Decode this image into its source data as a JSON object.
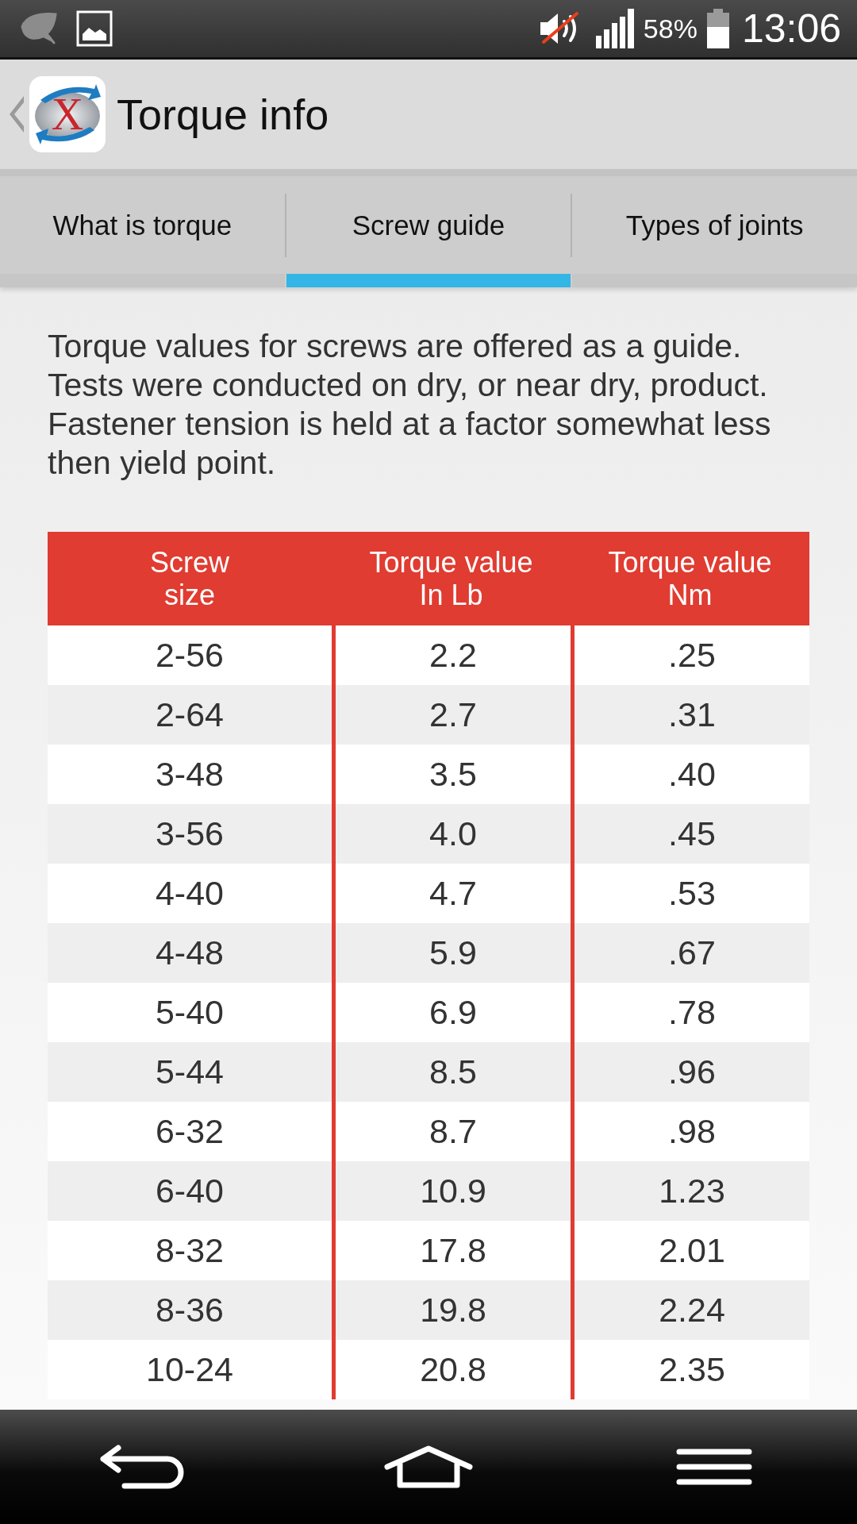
{
  "status_bar": {
    "battery": "58%",
    "time": "13:06"
  },
  "app_bar": {
    "logo_letter": "X",
    "title": "Torque info"
  },
  "tabs": [
    {
      "label": "What is torque",
      "selected": false
    },
    {
      "label": "Screw guide",
      "selected": true
    },
    {
      "label": "Types of joints",
      "selected": false
    }
  ],
  "intro": "Torque values for screws are offered as a guide. Tests were conducted on dry, or near dry, product. Fastener tension is held at a factor somewhat less then yield point.",
  "table": {
    "columns": [
      "Screw\nsize",
      "Torque value\nIn Lb",
      "Torque value\nNm"
    ],
    "rows": [
      [
        "2-56",
        "2.2",
        ".25"
      ],
      [
        "2-64",
        "2.7",
        ".31"
      ],
      [
        "3-48",
        "3.5",
        ".40"
      ],
      [
        "3-56",
        "4.0",
        ".45"
      ],
      [
        "4-40",
        "4.7",
        ".53"
      ],
      [
        "4-48",
        "5.9",
        ".67"
      ],
      [
        "5-40",
        "6.9",
        ".78"
      ],
      [
        "5-44",
        "8.5",
        ".96"
      ],
      [
        "6-32",
        "8.7",
        ".98"
      ],
      [
        "6-40",
        "10.9",
        "1.23"
      ],
      [
        "8-32",
        "17.8",
        "2.01"
      ],
      [
        "8-36",
        "19.8",
        "2.24"
      ],
      [
        "10-24",
        "20.8",
        "2.35"
      ]
    ]
  }
}
